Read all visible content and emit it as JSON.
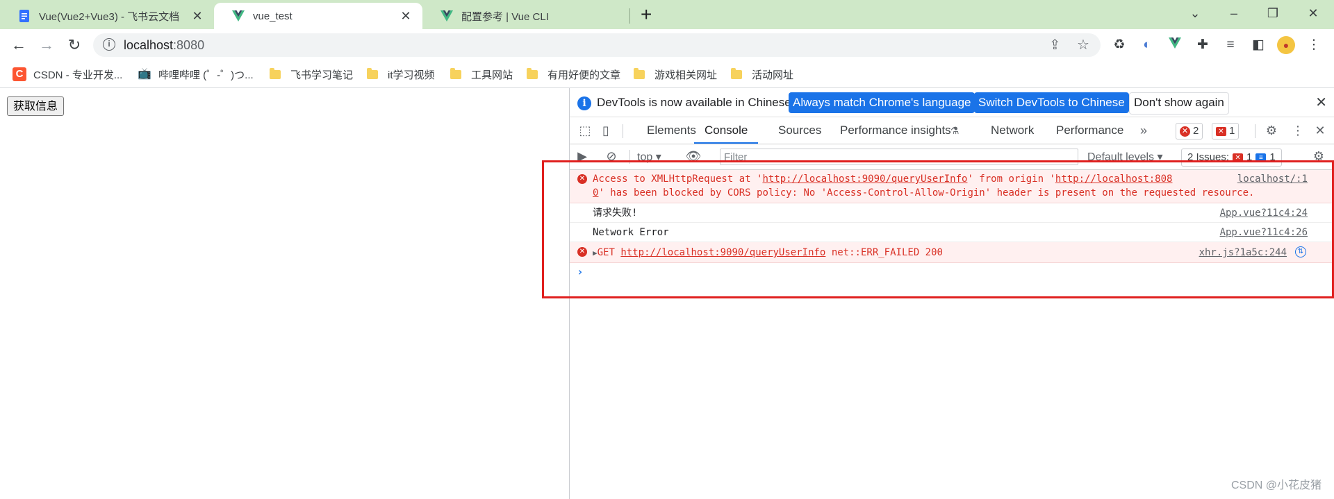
{
  "browser": {
    "tabs": [
      {
        "title": "Vue(Vue2+Vue3) - 飞书云文档",
        "icon": "doc-icon"
      },
      {
        "title": "vue_test",
        "icon": "vue-icon"
      },
      {
        "title": "配置参考 | Vue CLI",
        "icon": "vue-icon"
      }
    ],
    "active_tab": 1,
    "address": {
      "host": "localhost",
      "port": ":8080"
    },
    "bookmarks": [
      {
        "label": "CSDN - 专业开发...",
        "icon": "csdn-icon"
      },
      {
        "label": "哔哩哔哩 (゜-゜)つ...",
        "icon": "bilibili-icon"
      },
      {
        "label": "飞书学习笔记",
        "icon": "folder-icon"
      },
      {
        "label": "it学习视频",
        "icon": "folder-icon"
      },
      {
        "label": "工具网站",
        "icon": "folder-icon"
      },
      {
        "label": "有用好便的文章",
        "icon": "folder-icon"
      },
      {
        "label": "游戏相关网址",
        "icon": "folder-icon"
      },
      {
        "label": "活动网址",
        "icon": "folder-icon"
      }
    ]
  },
  "page": {
    "button_label": "获取信息"
  },
  "devtools": {
    "infobar": {
      "text": "DevTools is now available in Chinese!",
      "btn_match": "Always match Chrome's language",
      "btn_switch": "Switch DevTools to Chinese",
      "btn_dismiss": "Don't show again"
    },
    "tabs": [
      "Elements",
      "Console",
      "Sources",
      "Performance insights",
      "Network",
      "Performance"
    ],
    "active_tab": "Console",
    "error_count": "2",
    "warning_count": "1",
    "console_toolbar": {
      "context": "top",
      "filter_placeholder": "Filter",
      "levels": "Default levels",
      "issues_label": "2 Issues:",
      "issues_errors": "1",
      "issues_info": "1"
    },
    "messages": [
      {
        "level": "error",
        "line1_pre": "Access to XMLHttpRequest at '",
        "line1_url": "http://localhost:9090/queryUserInfo",
        "line1_mid": "' from origin '",
        "line1_url2": "http://localhost:808",
        "line2_url2": "0",
        "line2_text": "' has been blocked by CORS policy: No 'Access-Control-Allow-Origin' header is present on the requested resource.",
        "source_line1": "localhost/:1",
        "source_line1a": "localhost/:1"
      },
      {
        "level": "log",
        "text": "请求失败!",
        "source": "App.vue?11c4:24"
      },
      {
        "level": "log",
        "text": "Network Error",
        "source": "App.vue?11c4:26"
      },
      {
        "level": "error",
        "method": "GET",
        "url": "http://localhost:9090/queryUserInfo",
        "status": "net::ERR_FAILED 200",
        "source": "xhr.js?1a5c:244"
      }
    ]
  },
  "watermark": "CSDN @小花皮猪",
  "colors": {
    "tabstrip": "#cfe8c8",
    "error": "#d93025",
    "accent": "#1a73e8",
    "annotation": "#e0201f"
  }
}
